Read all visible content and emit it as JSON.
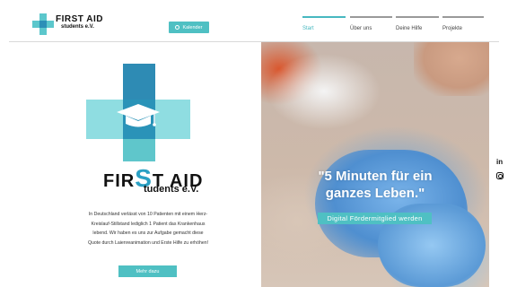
{
  "brand": {
    "line1": "FIRST AID",
    "line2": "students e.V.",
    "big_line1_a": "FIR",
    "big_line1_s": "S",
    "big_line1_b": "T AID",
    "big_line2": "tudents e.V."
  },
  "header": {
    "calendar_label": "Kalender"
  },
  "nav": [
    {
      "label": "Start",
      "active": true
    },
    {
      "label": "Über uns",
      "active": false
    },
    {
      "label": "Deine Hilfe",
      "active": false
    },
    {
      "label": "Projekte",
      "active": false
    }
  ],
  "intro": {
    "text": "In Deutschland verlässt von 10 Patienten mit einem Herz-Kreislauf-Stillstand lediglich 1 Patient das Krankenhaus lebend. Wir haben es uns zur Aufgabe gemacht diese Quote durch Laienreanimation und Erste Hilfe zu erhöhen!",
    "button": "Mehr dazu"
  },
  "hero": {
    "quote_line1": "\"5 Minuten für ein",
    "quote_line2": "ganzes Leben.\"",
    "button": "Digital Fördermitglied werden"
  },
  "social": {
    "linkedin": "in"
  },
  "colors": {
    "accent": "#4fc0c3",
    "cross_dark": "#2e8bb4",
    "cross_light": "#8fdde1"
  }
}
